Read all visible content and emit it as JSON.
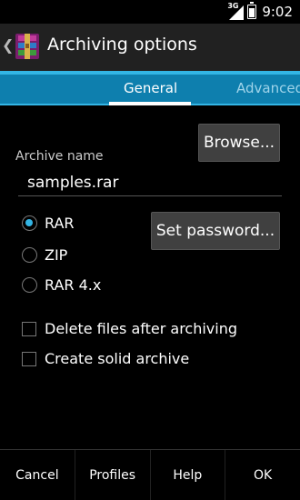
{
  "status_bar": {
    "network_label": "3G",
    "time": "9:02"
  },
  "action_bar": {
    "title": "Archiving options",
    "icon": "winrar-icon"
  },
  "tabs": [
    {
      "label": "General",
      "selected": true
    },
    {
      "label": "Advanced",
      "selected": false
    }
  ],
  "archive": {
    "label": "Archive name",
    "value": "samples.rar",
    "browse_label": "Browse...",
    "password_label": "Set password..."
  },
  "formats": [
    {
      "label": "RAR",
      "selected": true
    },
    {
      "label": "ZIP",
      "selected": false
    },
    {
      "label": "RAR 4.x",
      "selected": false
    }
  ],
  "options": [
    {
      "label": "Delete files after archiving",
      "checked": false
    },
    {
      "label": "Create solid archive",
      "checked": false
    }
  ],
  "bottom_bar": {
    "cancel": "Cancel",
    "profiles": "Profiles",
    "help": "Help",
    "ok": "OK"
  },
  "colors": {
    "accent": "#33b5e5",
    "tab_bg": "#0e7fae",
    "action_bar_bg": "#212121"
  }
}
